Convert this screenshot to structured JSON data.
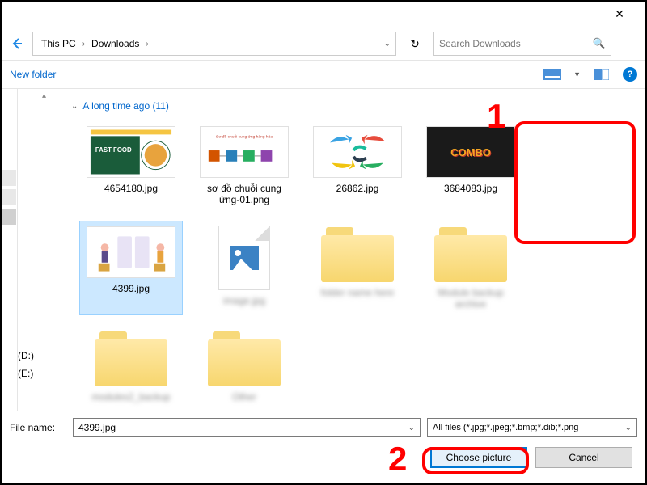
{
  "titlebar": {
    "close_label": "✕"
  },
  "nav": {
    "breadcrumb": [
      "This PC",
      "Downloads"
    ],
    "refresh_glyph": "↻",
    "search_placeholder": "Search Downloads",
    "search_glyph": "🔍"
  },
  "toolbar": {
    "new_folder_label": "New folder",
    "help_glyph": "?"
  },
  "group": {
    "label": "A long time ago (11)"
  },
  "files": {
    "row1": [
      {
        "name": "4654180.jpg",
        "kind": "thumb-fastfood"
      },
      {
        "name": "sơ đồ chuỗi cung ứng-01.png",
        "kind": "thumb-diagram"
      },
      {
        "name": "26862.jpg",
        "kind": "thumb-arrows"
      },
      {
        "name": "3684083.jpg",
        "kind": "thumb-combo"
      },
      {
        "name": "4399.jpg",
        "kind": "thumb-people",
        "selected": true
      }
    ],
    "row2": [
      {
        "name": "image.jpg",
        "kind": "imgfile",
        "blurred": true
      },
      {
        "name": "folder name here",
        "kind": "folder",
        "blurred": true
      },
      {
        "name": "Module backup archive",
        "kind": "folder",
        "blurred": true
      },
      {
        "name": "modules2_backup",
        "kind": "folder",
        "blurred": true
      },
      {
        "name": "Other",
        "kind": "folder",
        "blurred": true
      }
    ]
  },
  "drives": [
    "(D:)",
    "(E:)"
  ],
  "bottom": {
    "filename_label": "File name:",
    "filename_value": "4399.jpg",
    "filetype_text": "All files (*.jpg;*.jpeg;*.bmp;*.dib;*.png",
    "choose_label": "Choose picture",
    "cancel_label": "Cancel"
  },
  "annotations": {
    "num1": "1",
    "num2": "2"
  },
  "combo_text": "COMBO"
}
